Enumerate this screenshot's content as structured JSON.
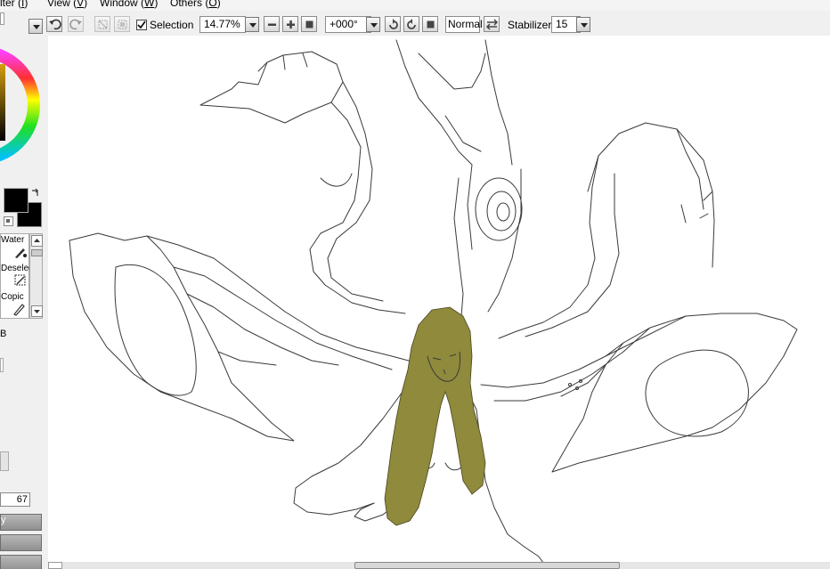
{
  "menu": {
    "items": [
      {
        "text": "lter",
        "key": "I"
      },
      {
        "text": "View",
        "key": "V"
      },
      {
        "text": "Window",
        "key": "W"
      },
      {
        "text": "Others",
        "key": "O"
      }
    ]
  },
  "toolbar": {
    "selection_label": "Selection",
    "selection_checked": true,
    "zoom_value": "14.77%",
    "rotation_value": "+000°",
    "blend_mode": "Normal",
    "stabilizer_label": "Stabilizer",
    "stabilizer_value": "15"
  },
  "left_panel": {
    "tools": [
      "Water",
      "Deselect",
      "Copic"
    ],
    "mode_label": "B",
    "brush_size_value": "67",
    "button_label": "y"
  },
  "colors": {
    "toolbar_bg": "#f0f0f0",
    "canvas_bg": "#ffffff",
    "hair": "#8f8a3c",
    "line": "#3a3a3a"
  }
}
